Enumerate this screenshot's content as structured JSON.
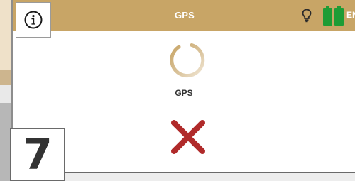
{
  "topbar": {
    "title": "GPS",
    "lang_label": "EN",
    "accent_color": "#c8a566",
    "battery_color": "#1e9c35"
  },
  "main": {
    "status_label": "GPS",
    "status_icon": "x-fail-icon",
    "spinner_icon": "loading-spinner-icon",
    "fail_color": "#b02a2a"
  },
  "step": {
    "number": "7"
  },
  "icons": {
    "info": "info-icon",
    "bulb": "lightbulb-icon",
    "battery": "battery-icon"
  }
}
